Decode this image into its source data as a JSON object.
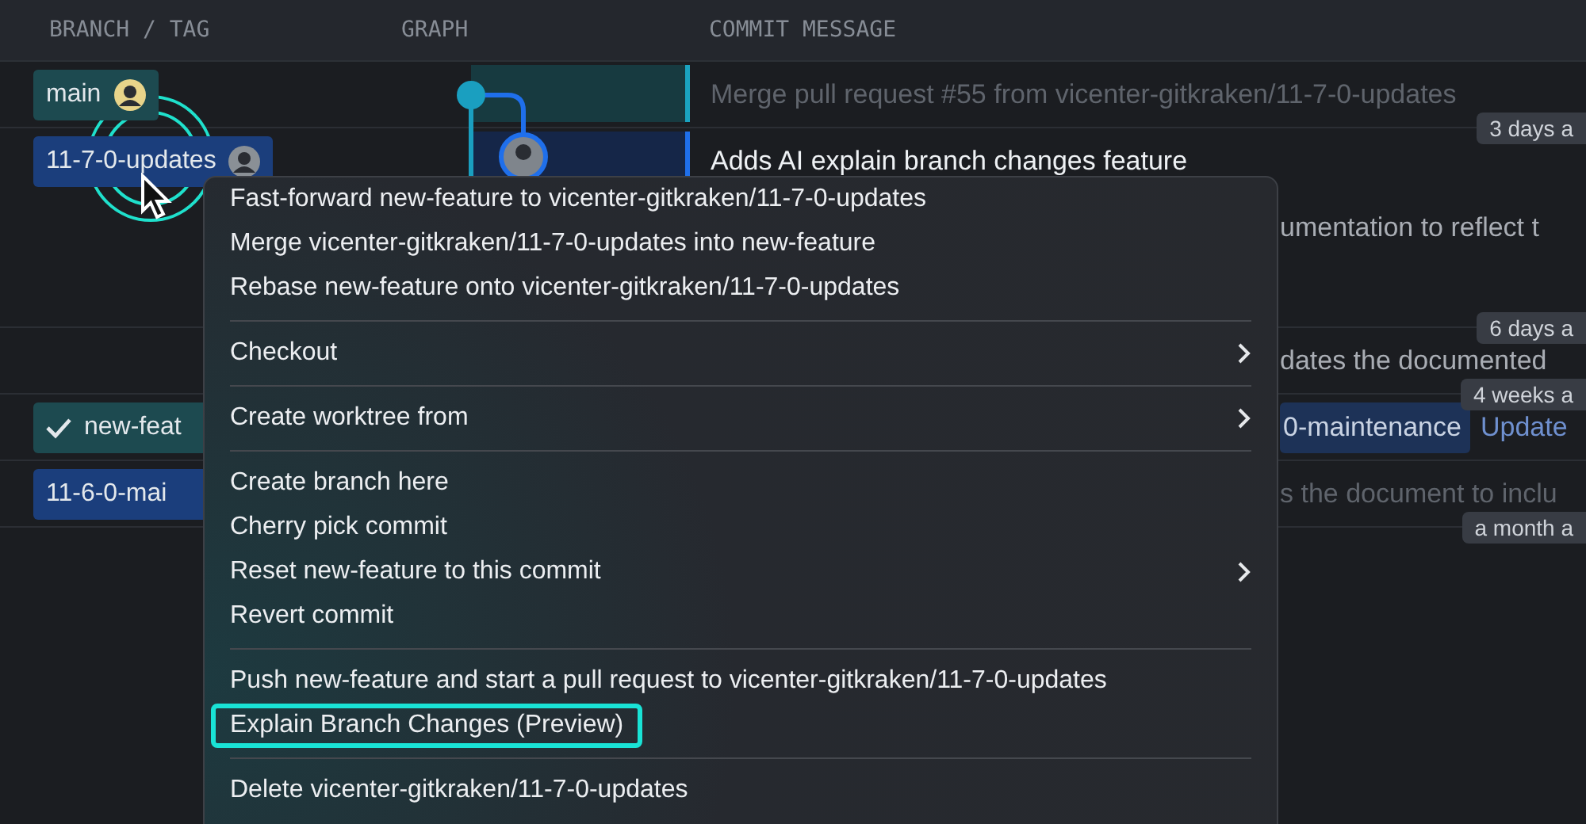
{
  "columns": [
    "BRANCH / TAG",
    "GRAPH",
    "COMMIT MESSAGE"
  ],
  "rows": [
    {
      "branch": {
        "label": "main",
        "kind": "local",
        "current": false,
        "avatar": true
      },
      "message": "Merge pull request #55 from vicenter-gitkraken/11-7-0-updates",
      "dimmed": true,
      "selected": false,
      "covered": false,
      "time": "3 days a"
    },
    {
      "branch": {
        "label": "11-7-0-updates",
        "kind": "remote",
        "current": false,
        "avatar": true
      },
      "message": "Adds AI explain branch changes feature",
      "dimmed": false,
      "selected": true,
      "covered": false
    },
    {
      "message": "umentation to reflect t",
      "dimmed": false,
      "selected": false,
      "covered": true
    },
    {
      "time": "6 days a"
    },
    {
      "message": "dates the documented",
      "dimmed": false,
      "selected": false,
      "covered": true,
      "time": "4 weeks a"
    },
    {
      "branch": {
        "label": "new-feat",
        "kind": "local",
        "current": true,
        "avatar": false
      },
      "tag": "0-maintenance",
      "message": "Update",
      "dimmed": false,
      "selected": false,
      "covered": true
    },
    {
      "branch": {
        "label": "11-6-0-mai",
        "kind": "remote",
        "current": false,
        "avatar": false
      },
      "message": "s the document to inclu",
      "dimmed": true,
      "selected": false,
      "covered": true,
      "time": "a month a"
    }
  ],
  "context_menu": {
    "groups": [
      [
        {
          "label": "Fast-forward new-feature to vicenter-gitkraken/11-7-0-updates",
          "submenu": false,
          "highlighted": false
        },
        {
          "label": "Merge vicenter-gitkraken/11-7-0-updates into new-feature",
          "submenu": false,
          "highlighted": false
        },
        {
          "label": "Rebase new-feature onto vicenter-gitkraken/11-7-0-updates",
          "submenu": false,
          "highlighted": false
        }
      ],
      [
        {
          "label": "Checkout",
          "submenu": true,
          "highlighted": false
        }
      ],
      [
        {
          "label": "Create worktree from",
          "submenu": true,
          "highlighted": false
        }
      ],
      [
        {
          "label": "Create branch here",
          "submenu": false,
          "highlighted": false
        },
        {
          "label": "Cherry pick commit",
          "submenu": false,
          "highlighted": false
        },
        {
          "label": "Reset new-feature to this commit",
          "submenu": true,
          "highlighted": false
        },
        {
          "label": "Revert commit",
          "submenu": false,
          "highlighted": false
        }
      ],
      [
        {
          "label": "Push new-feature and start a pull request to vicenter-gitkraken/11-7-0-updates",
          "submenu": false,
          "highlighted": false
        },
        {
          "label": "Explain Branch Changes (Preview)",
          "submenu": false,
          "highlighted": true
        }
      ],
      [
        {
          "label": "Delete vicenter-gitkraken/11-7-0-updates",
          "submenu": false,
          "highlighted": false
        }
      ]
    ]
  }
}
